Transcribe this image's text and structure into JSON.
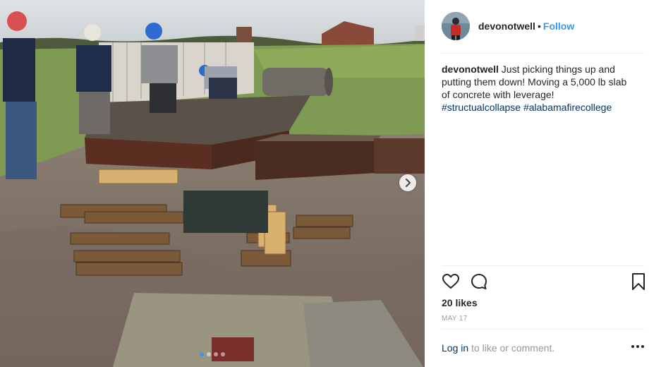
{
  "post": {
    "username": "devonotwell",
    "follow_label": "Follow",
    "bullet": "•",
    "caption_text": "Just picking things up and putting them down! Moving a 5,000 lb slab of concrete with leverage!",
    "hashtags": [
      "#structualcollapse",
      "#alabamafirecollege"
    ],
    "likes": "20 likes",
    "date": "MAY 17",
    "login_link": "Log in",
    "login_suffix": "to like or comment.",
    "carousel_dots": 4,
    "active_dot": 0
  },
  "icons": {
    "like": "heart-icon",
    "comment": "comment-icon",
    "save": "bookmark-icon",
    "more": "more-options-icon",
    "next": "chevron-right-icon"
  },
  "colors": {
    "link_blue": "#3897f0",
    "hashtag": "#003569",
    "muted": "#999999",
    "text": "#262626"
  }
}
